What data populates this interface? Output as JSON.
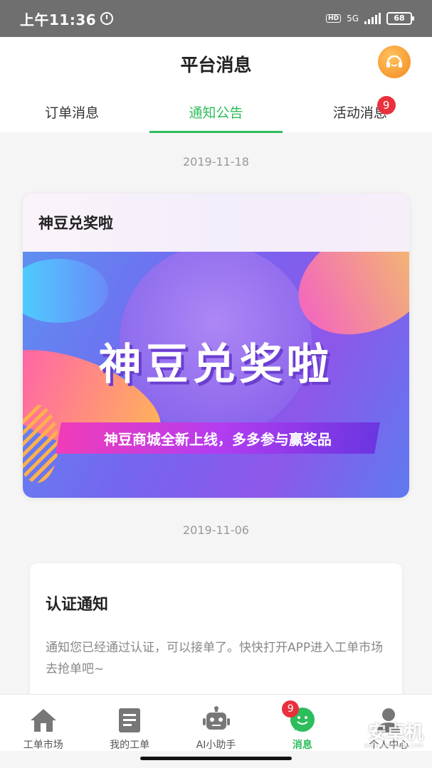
{
  "status_bar": {
    "time": "上午11:36",
    "network": "5G",
    "hd": "HD",
    "battery": "68"
  },
  "header": {
    "title": "平台消息",
    "service_icon": "headset-icon"
  },
  "tabs": [
    {
      "label": "订单消息",
      "active": false
    },
    {
      "label": "通知公告",
      "active": true
    },
    {
      "label": "活动消息",
      "active": false,
      "badge": "9"
    }
  ],
  "feed": [
    {
      "date": "2019-11-18",
      "title": "神豆兑奖啦",
      "banner_headline": "神豆兑奖啦",
      "banner_subtitle": "神豆商城全新上线，多多参与赢奖品"
    },
    {
      "date": "2019-11-06",
      "title": "认证通知",
      "body": "通知您已经通过认证，可以接单了。快快打开APP进入工单市场去抢单吧~"
    }
  ],
  "bottom_nav": [
    {
      "label": "工单市场",
      "icon": "home-icon",
      "active": false
    },
    {
      "label": "我的工单",
      "icon": "document-icon",
      "active": false
    },
    {
      "label": "AI小助手",
      "icon": "robot-icon",
      "active": false
    },
    {
      "label": "消息",
      "icon": "chat-icon",
      "active": true,
      "badge": "9"
    },
    {
      "label": "个人中心",
      "icon": "person-icon",
      "active": false
    }
  ],
  "watermark": {
    "text": "安卓机",
    "url": "www.anzhuoji.com"
  },
  "colors": {
    "accent": "#2dbd5c",
    "badge": "#e8313c",
    "service": "#f28a1c"
  }
}
